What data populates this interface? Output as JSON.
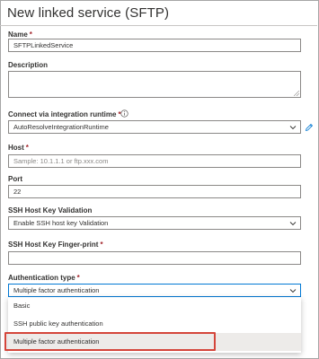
{
  "panel": {
    "title": "New linked service (SFTP)"
  },
  "fields": {
    "name": {
      "label": "Name",
      "required_mark": "*",
      "value": "SFTPLinkedService"
    },
    "description": {
      "label": "Description",
      "value": ""
    },
    "runtime": {
      "label": "Connect via integration runtime",
      "required_mark": "*",
      "value": "AutoResolveIntegrationRuntime"
    },
    "host": {
      "label": "Host",
      "required_mark": "*",
      "placeholder": "Sample: 10.1.1.1 or ftp.xxx.com"
    },
    "port": {
      "label": "Port",
      "value": "22"
    },
    "ssh_validation": {
      "label": "SSH Host Key Validation",
      "value": "Enable SSH host key Validation"
    },
    "fingerprint": {
      "label": "SSH Host Key Finger-print",
      "required_mark": "*",
      "value": ""
    },
    "auth_type": {
      "label": "Authentication type",
      "required_mark": "*",
      "value": "Multiple factor authentication",
      "options": [
        "Basic",
        "SSH public key authentication",
        "Multiple factor authentication"
      ],
      "selected_index": 2
    }
  },
  "colors": {
    "accent": "#0078d4",
    "required": "#a4262c",
    "highlight": "#d4453a"
  },
  "icons": {
    "runtime_info": "info-icon",
    "runtime_edit": "pencil-icon",
    "dropdown": "chevron-down-icon"
  }
}
